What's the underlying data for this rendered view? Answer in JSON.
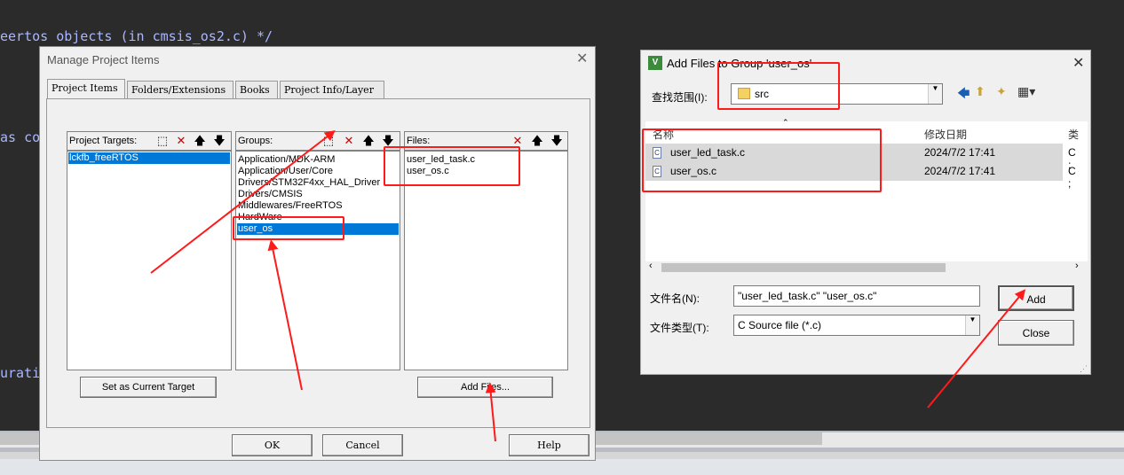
{
  "editor": {
    "line1": "eertos objects (in cmsis_os2.c) */",
    "line2": "as co",
    "line3": "urati"
  },
  "manage_dialog": {
    "title": "Manage Project Items",
    "tabs": [
      "Project Items",
      "Folders/Extensions",
      "Books",
      "Project Info/Layer"
    ],
    "targets": {
      "header": "Project Targets:",
      "items": [
        "lckfb_freeRTOS"
      ],
      "selected": 0
    },
    "groups": {
      "header": "Groups:",
      "items": [
        "Application/MDK-ARM",
        "Application/User/Core",
        "Drivers/STM32F4xx_HAL_Driver",
        "Drivers/CMSIS",
        "Middlewares/FreeRTOS",
        "HardWare",
        "user_os"
      ],
      "selected": 6
    },
    "files": {
      "header": "Files:",
      "items": [
        "user_led_task.c",
        "user_os.c"
      ]
    },
    "set_current_label": "Set as Current Target",
    "add_files_label": "Add Files...",
    "ok_label": "OK",
    "cancel_label": "Cancel",
    "help_label": "Help"
  },
  "add_dialog": {
    "title": "Add Files to Group 'user_os'",
    "lookin_label": "查找范围(I):",
    "lookin_value": "src",
    "col_name": "名称",
    "col_date": "修改日期",
    "col_type": "类",
    "files": [
      {
        "name": "user_led_task.c",
        "date": "2024/7/2 17:41",
        "type": "C ;"
      },
      {
        "name": "user_os.c",
        "date": "2024/7/2 17:41",
        "type": "C ;"
      }
    ],
    "filename_label": "文件名(N):",
    "filename_value": "\"user_led_task.c\" \"user_os.c\"",
    "filetype_label": "文件类型(T):",
    "filetype_value": "C Source file (*.c)",
    "add_label": "Add",
    "close_label": "Close"
  },
  "colors": {
    "selection": "#0078d7",
    "annotation": "#ff1a1a",
    "editor_bg": "#2b2b2b"
  }
}
